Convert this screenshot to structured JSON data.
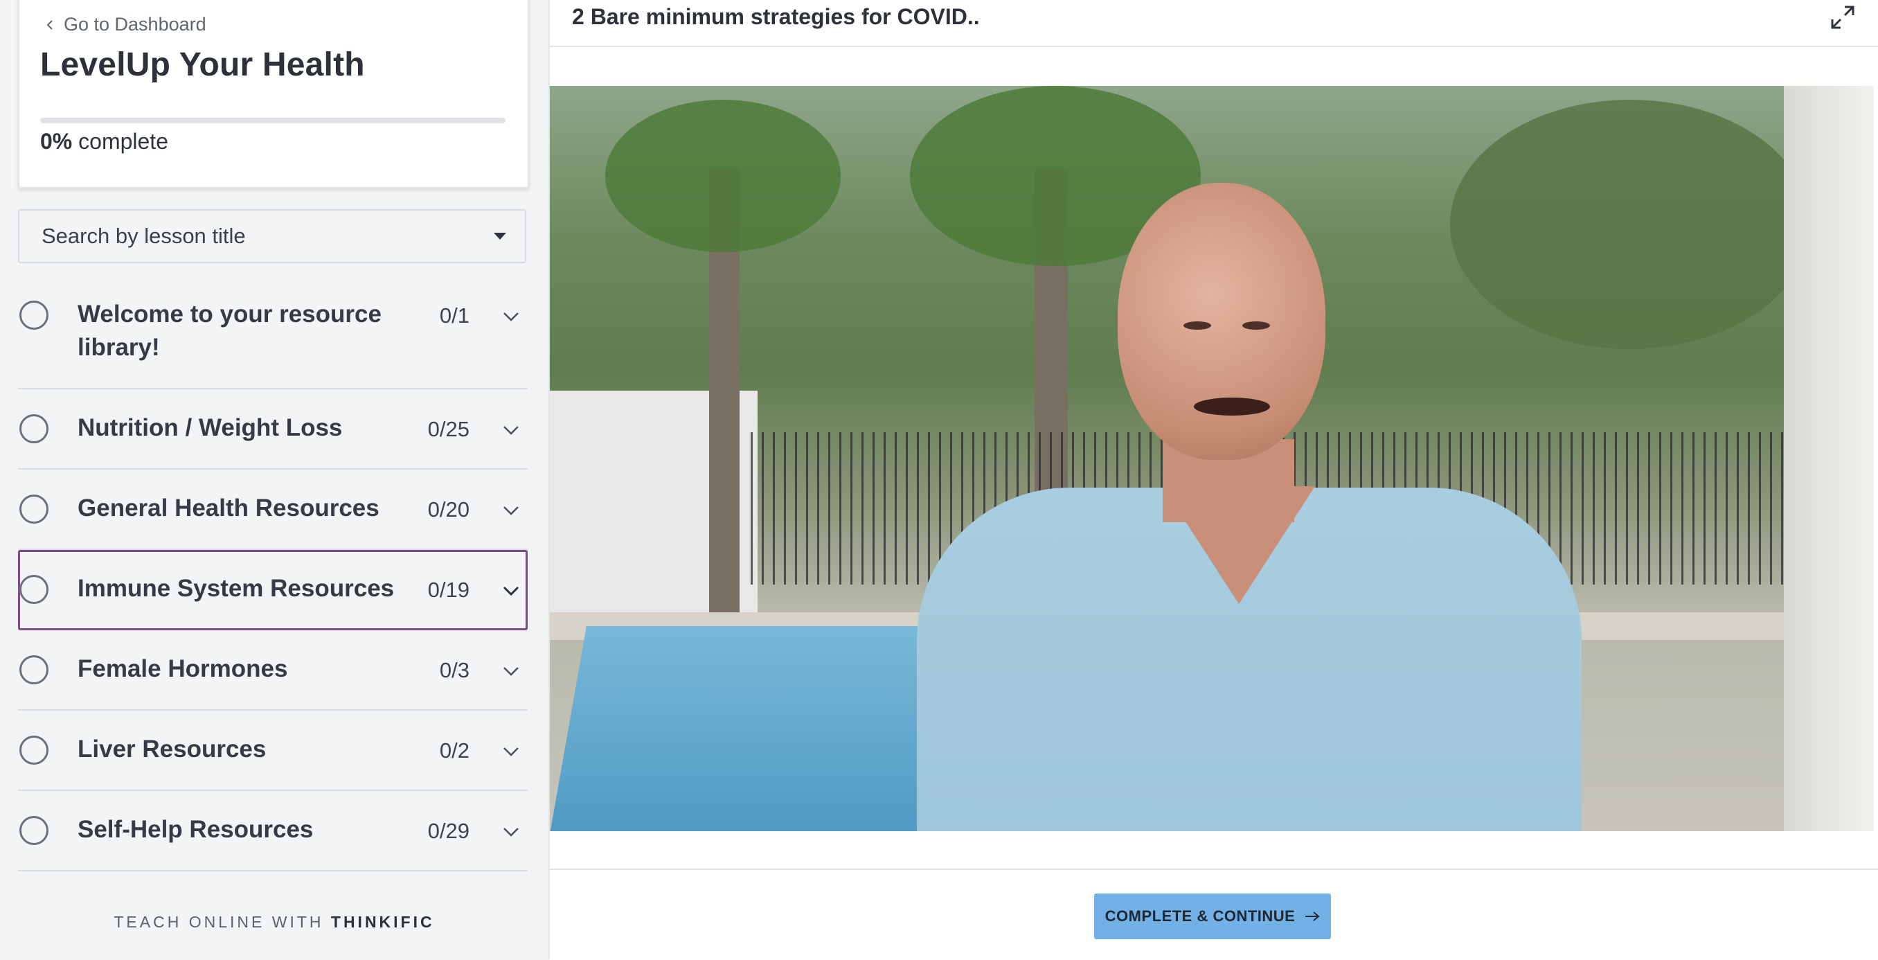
{
  "sidebar": {
    "back_label": "Go to Dashboard",
    "course_title": "LevelUp Your Health",
    "progress_percent": 0,
    "progress_value": "0%",
    "progress_suffix": "complete",
    "search_label": "Search by lesson title",
    "chapters": [
      {
        "title": "Welcome to your resource library!",
        "count": "0/1"
      },
      {
        "title": "Nutrition / Weight Loss",
        "count": "0/25"
      },
      {
        "title": "General Health Resources",
        "count": "0/20"
      },
      {
        "title": "Immune System Resources",
        "count": "0/19",
        "active": true
      },
      {
        "title": "Female Hormones",
        "count": "0/3"
      },
      {
        "title": "Liver Resources",
        "count": "0/2"
      },
      {
        "title": "Self-Help Resources",
        "count": "0/29"
      }
    ],
    "footer_prefix": "TEACH ONLINE WITH",
    "footer_brand": "THINKIFIC"
  },
  "main": {
    "lesson_title": "2 Bare minimum strategies for COVID..",
    "complete_button": "COMPLETE & CONTINUE"
  },
  "colors": {
    "accent": "#7e4a8a",
    "button": "#72b0e6",
    "sidebar_bg": "#f3f4f6"
  },
  "icons": {
    "back": "chevron-left-icon",
    "search_caret": "caret-down-icon",
    "chapter_toggle": "chevron-down-icon",
    "expand": "expand-icon",
    "continue": "arrow-right-icon"
  }
}
